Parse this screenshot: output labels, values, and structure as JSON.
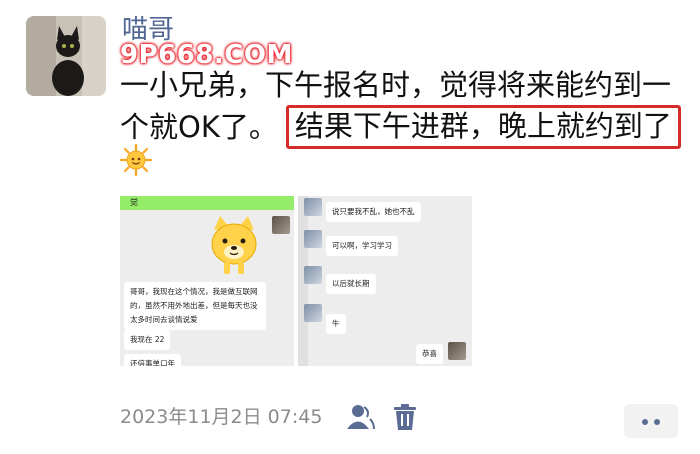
{
  "post": {
    "author": "喵哥",
    "watermark_text": "9P668.COM",
    "text_line1": "一小兄弟，下午报名时，觉得将来能约到一",
    "text_line2_prefix": "个就OK了。",
    "text_highlight": "结果下午进群，晚上就约到了",
    "emoji": "sun-emoji"
  },
  "screenshot_left": {
    "header": "觉",
    "msg1": "哥哥，我现在这个情况，我是做互联网的，虽然不用外地出差，但是每天也没太多时间去谈情说爱",
    "msg2": "我现在 22",
    "msg3": "还倍事单口年"
  },
  "screenshot_right": {
    "msg1": "说只要我不乱，她也不乱",
    "msg2": "可以啊，学习学习",
    "msg3": "以后就长期",
    "msg4": "牛",
    "msg5": "恭喜"
  },
  "footer": {
    "timestamp": "2023年11月2日 07:45",
    "icons": [
      "visibility-person-icon",
      "delete-trash-icon",
      "more-dots-icon"
    ]
  },
  "colors": {
    "author": "#4f6592",
    "highlight_border": "#d52b2b",
    "footer_text": "#8b8b8b",
    "icon": "#5b6c94",
    "wechat_green": "#95ec69"
  }
}
